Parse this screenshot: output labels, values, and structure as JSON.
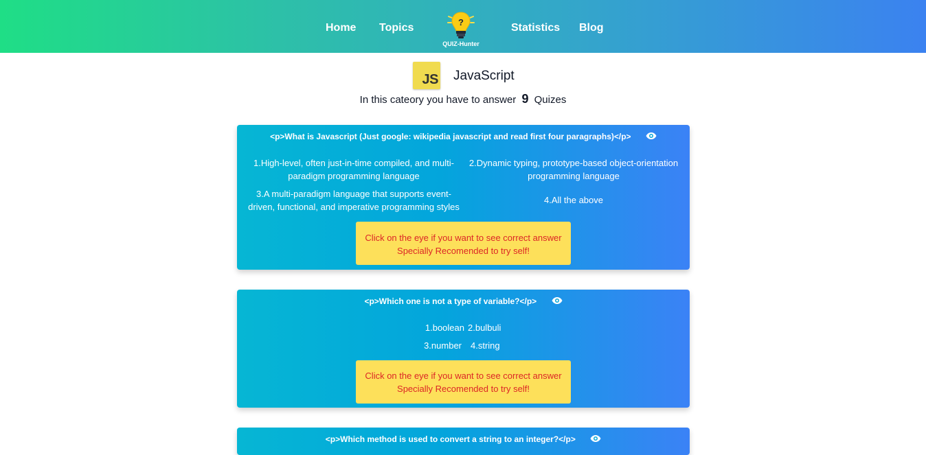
{
  "nav": {
    "links": [
      "Home",
      "Topics",
      "Statistics",
      "Blog"
    ],
    "logo_text": "QUIZ-Hunter"
  },
  "category": {
    "badge": "JS",
    "name": "JavaScript",
    "intro": "In this cateory you have to answer",
    "count": "9",
    "suffix": "Quizes"
  },
  "quizzes": [
    {
      "question": "<p>What is Javascript (Just google: wikipedia javascript and read first four paragraphs)</p>",
      "options": [
        "1.High-level, often just-in-time compiled, and multi-paradigm programming language",
        "2.Dynamic typing, prototype-based object-orientation programming language",
        "3.A multi-paradigm language that supports event-driven, functional, and imperative programming styles",
        "4.All the above"
      ],
      "hint_line1": "Click on the eye if you want to see correct answer",
      "hint_line2": "Specially Recomended to try self!"
    },
    {
      "question": "<p>Which one is not a type of variable?</p>",
      "options": [
        "1.boolean",
        "2.bulbuli",
        "3.number",
        "4.string"
      ],
      "hint_line1": "Click on the eye if you want to see correct answer",
      "hint_line2": "Specially Recomended to try self!"
    },
    {
      "question": "<p>Which method is used to convert a string to an integer?</p>"
    }
  ],
  "colors": {
    "nav_gradient_start": "#1fde86",
    "nav_gradient_end": "#3b82f0",
    "card_gradient_start": "#06b6d4",
    "card_gradient_end": "#3b82f6",
    "hint_bg": "#fde05a",
    "hint_text": "#dc2626",
    "js_badge": "#f0db4f"
  }
}
